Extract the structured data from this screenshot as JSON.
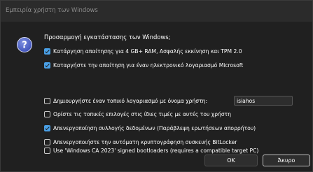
{
  "window": {
    "title": "Εμπειρία χρήστη των Windows"
  },
  "prompt": {
    "icon": "question-icon",
    "text": "Προσαρμογή εγκατάστασης των Windows;"
  },
  "options": [
    {
      "label": "Κατάργηση απαίτησης για 4 GB+ RAM, Ασφαλής εκκίνηση και TPM 2.0",
      "checked": true
    },
    {
      "label": "Καταργήστε την απαίτηση για έναν ηλεκτρονικό λογαριασμό Microsoft",
      "checked": true
    },
    {
      "label": "Δημιουργήστε έναν τοπικό λογαριασμό με όνομα χρήστη:",
      "checked": false
    },
    {
      "label": "Ορίστε τις τοπικές επιλογές στις ίδιες τιμές με αυτές του χρήστη",
      "checked": false
    },
    {
      "label": "Απενεργοποίηση συλλογής δεδομένων (Παράβλεψη ερωτήσεων απορρήτου)",
      "checked": true
    },
    {
      "label": "Απενεργοποιήστε την αυτόματη κρυπτογράφηση συσκευής BitLocker",
      "checked": false
    },
    {
      "label": "Use 'Windows CA 2023' signed bootloaders (requires a compatible target PC)",
      "checked": false
    }
  ],
  "username_field": {
    "value": "isiahos"
  },
  "buttons": {
    "ok": "OK",
    "cancel": "Άκυρο"
  },
  "colors": {
    "accent": "#4aa0e6",
    "background": "#202020",
    "titlebar": "#2b2b2b"
  }
}
